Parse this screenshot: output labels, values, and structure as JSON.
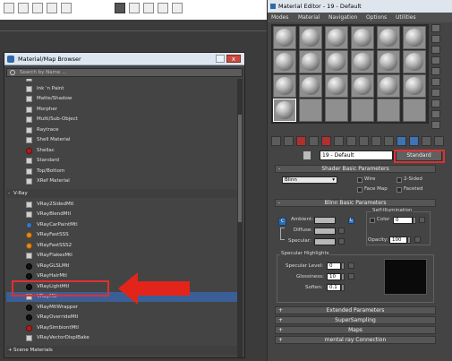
{
  "browser": {
    "title": "Material/Map Browser",
    "close": "x",
    "search_placeholder": "Search by Name ...",
    "standard_items": [
      {
        "label": "Double Sided",
        "icon": "gray"
      },
      {
        "label": "Ink 'n Paint",
        "icon": "gray"
      },
      {
        "label": "Matte/Shadow",
        "icon": "gray"
      },
      {
        "label": "Morpher",
        "icon": "gray"
      },
      {
        "label": "Multi/Sub-Object",
        "icon": "gray"
      },
      {
        "label": "Raytrace",
        "icon": "gray"
      },
      {
        "label": "Shell Material",
        "icon": "gray"
      },
      {
        "label": "Shellac",
        "icon": "red"
      },
      {
        "label": "Standard",
        "icon": "gray"
      },
      {
        "label": "Top/Bottom",
        "icon": "gray"
      },
      {
        "label": "XRef Material",
        "icon": "gray"
      }
    ],
    "vray_section": {
      "expander": "-",
      "label": "V-Ray"
    },
    "vray_items": [
      {
        "label": "VRay2SidedMtl",
        "icon": "gray"
      },
      {
        "label": "VRayBlendMtl",
        "icon": "gray"
      },
      {
        "label": "VRayCarPaintMtl",
        "icon": "blue"
      },
      {
        "label": "VRayFastSSS",
        "icon": "orange"
      },
      {
        "label": "VRayFastSSS2",
        "icon": "orange"
      },
      {
        "label": "VRayFlakesMtl",
        "icon": "gray"
      },
      {
        "label": "VRayGLSLMtl",
        "icon": "black"
      },
      {
        "label": "VRayHairMtl",
        "icon": "black"
      },
      {
        "label": "VRayLightMtl",
        "icon": "black"
      },
      {
        "label": "VRayMtl",
        "icon": "gray"
      },
      {
        "label": "VRayMtlWrapper",
        "icon": "black"
      },
      {
        "label": "VRayOverrideMtl",
        "icon": "black"
      },
      {
        "label": "VRaySimbiontMtl",
        "icon": "red"
      },
      {
        "label": "VRayVectorDisplBake",
        "icon": "gray"
      }
    ],
    "selected_label": "VRayMtl",
    "scene_section": {
      "expander": "+",
      "label": "Scene Materials"
    }
  },
  "editor": {
    "title": "Material Editor - 19 - Default",
    "menu": [
      "Modes",
      "Material",
      "Navigation",
      "Options",
      "Utilities"
    ],
    "material_name": "19 - Default",
    "material_type": "Standard",
    "rollouts": {
      "shader_basic": {
        "expander": "-",
        "title": "Shader Basic Parameters",
        "shader": "Blinn",
        "wire": "Wire",
        "two_sided": "2-Sided",
        "face_map": "Face Map",
        "faceted": "Faceted"
      },
      "blinn_basic": {
        "expander": "-",
        "title": "Blinn Basic Parameters",
        "self_illum": "Self-Illumination",
        "color": "Color",
        "color_value": "0",
        "ambient": "Ambient:",
        "diffuse": "Diffuse:",
        "specular": "Specular:",
        "opacity": "Opacity:",
        "opacity_value": "100",
        "lock_c": "C",
        "lock_l": "L"
      },
      "specular_highlights": {
        "title": "Specular Highlights",
        "level": "Specular Level:",
        "level_value": "0",
        "gloss": "Glossiness:",
        "gloss_value": "10",
        "soften": "Soften:",
        "soften_value": "0.1"
      },
      "collapsed": [
        {
          "expander": "+",
          "title": "Extended Parameters"
        },
        {
          "expander": "+",
          "title": "SuperSampling"
        },
        {
          "expander": "+",
          "title": "Maps"
        },
        {
          "expander": "+",
          "title": "mental ray Connection"
        }
      ]
    }
  },
  "colors": {
    "panel": "#444444",
    "highlight_red": "#e03030",
    "selection": "#3a5f96"
  }
}
